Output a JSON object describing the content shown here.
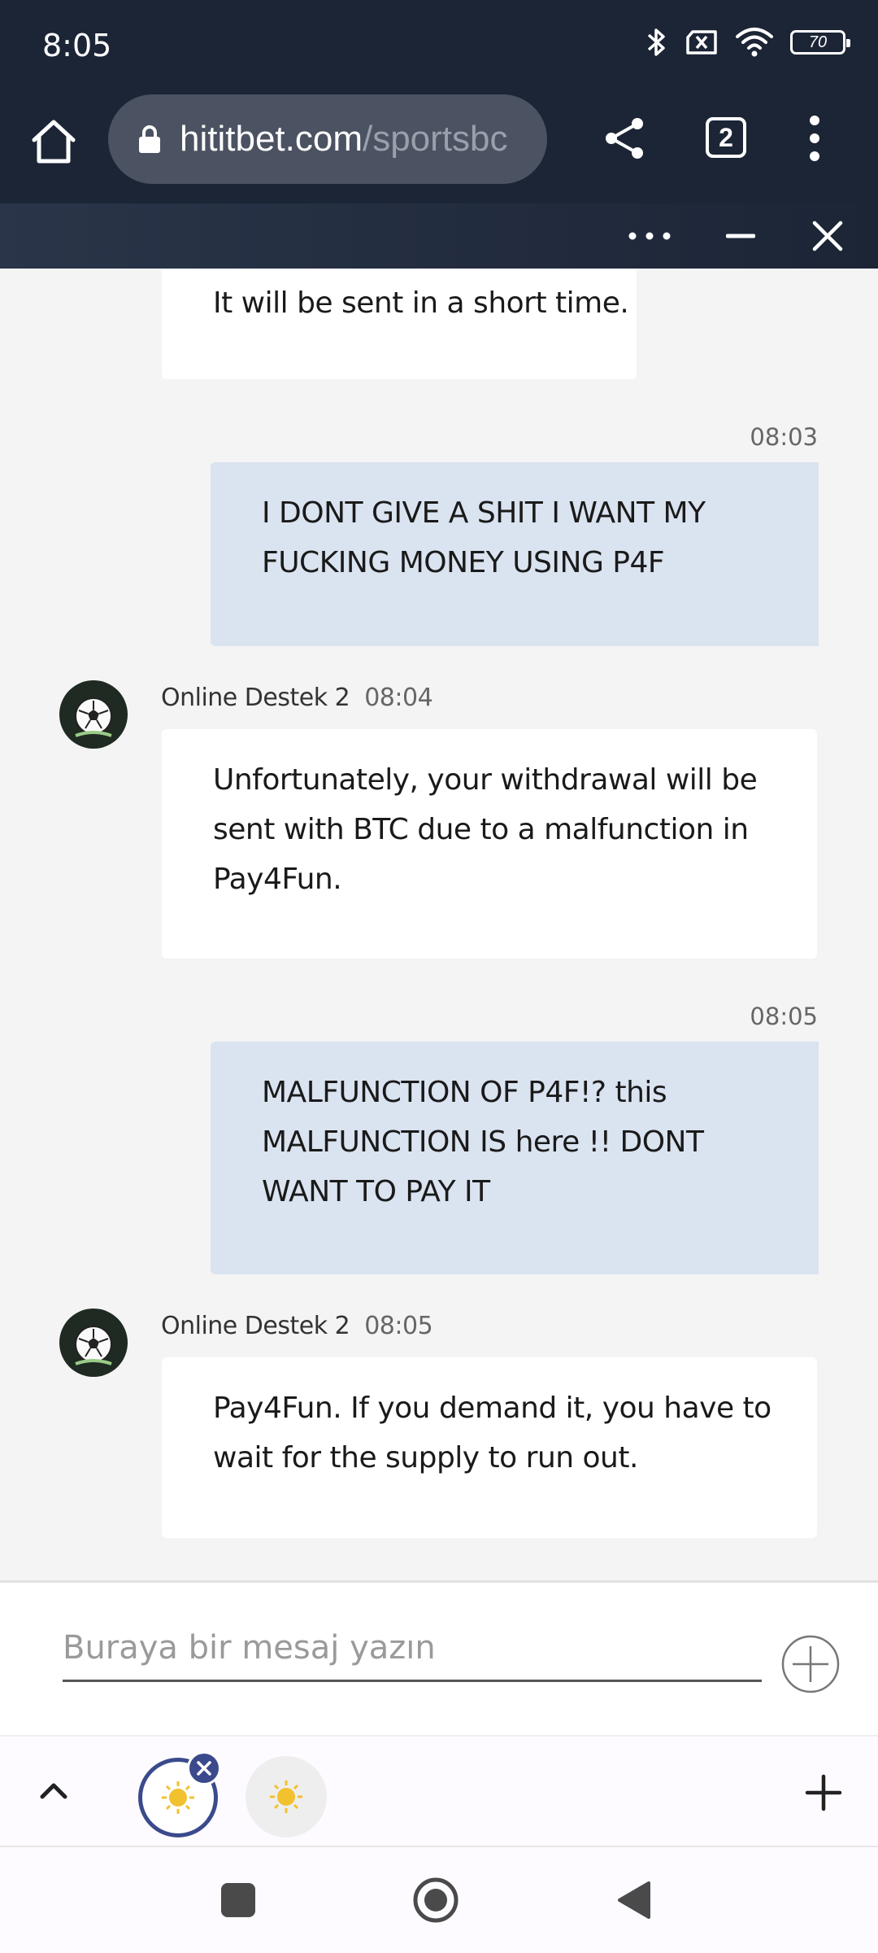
{
  "status_bar": {
    "time": "8:05",
    "battery": "70",
    "icons": [
      "bluetooth-icon",
      "no-sim-icon",
      "wifi-icon",
      "battery-icon"
    ]
  },
  "browser": {
    "url_host": "hititbet.com",
    "url_path": "/sportsbc",
    "tab_count": "2"
  },
  "messages": [
    {
      "role": "agent",
      "text": "It will be sent in a short time."
    },
    {
      "role": "user",
      "time": "08:03",
      "text": "I DONT GIVE A SHIT I WANT MY FUCKING MONEY USING P4F"
    },
    {
      "role": "agent",
      "sender": "Online Destek 2",
      "time": "08:04",
      "text": "Unfortunately, your withdrawal will be sent with BTC due to a malfunction in Pay4Fun."
    },
    {
      "role": "user",
      "time": "08:05",
      "text": "MALFUNCTION OF P4F!? this MALFUNCTION IS here !! DONT WANT TO PAY IT"
    },
    {
      "role": "agent",
      "sender": "Online Destek 2",
      "time": "08:05",
      "text": "Pay4Fun. If you demand it, you have to wait for the supply to run out."
    }
  ],
  "input": {
    "placeholder": "Buraya bir mesaj yazın"
  },
  "colors": {
    "header_bg": "#1c2536",
    "user_bubble": "#dae3f0",
    "agent_bubble": "#ffffff",
    "chat_bg": "#f4f4f4",
    "accent": "#3b4a8c"
  }
}
